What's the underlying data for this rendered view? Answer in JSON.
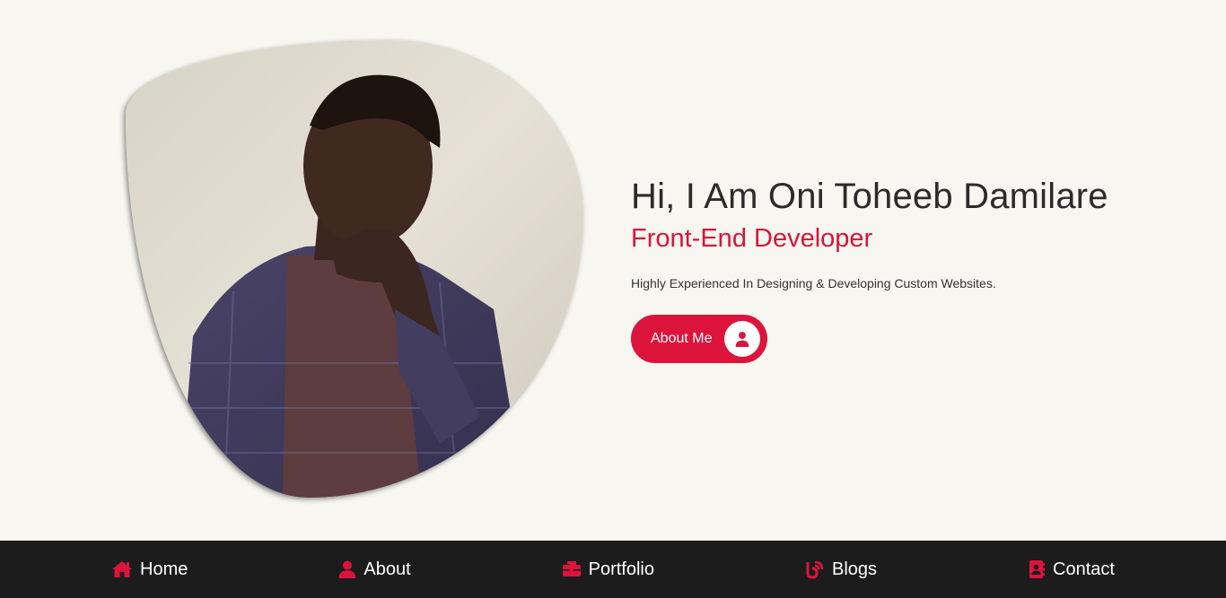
{
  "hero": {
    "title": "Hi, I Am Oni Toheeb Damilare",
    "subtitle": "Front-End Developer",
    "description": "Highly Experienced In Designing & Developing Custom Websites.",
    "cta": {
      "label": "About Me",
      "icon": "user-icon"
    }
  },
  "portrait": {
    "alt": "portrait photo"
  },
  "nav": {
    "items": [
      {
        "label": "Home",
        "icon": "home-icon"
      },
      {
        "label": "About",
        "icon": "user-icon"
      },
      {
        "label": "Portfolio",
        "icon": "briefcase-icon"
      },
      {
        "label": "Blogs",
        "icon": "blog-icon"
      },
      {
        "label": "Contact",
        "icon": "address-book-icon"
      }
    ]
  },
  "colors": {
    "accent": "#dc143c",
    "background": "#f7f6f0",
    "nav_background": "#1c1c1c",
    "text": "#2b2b2b"
  }
}
